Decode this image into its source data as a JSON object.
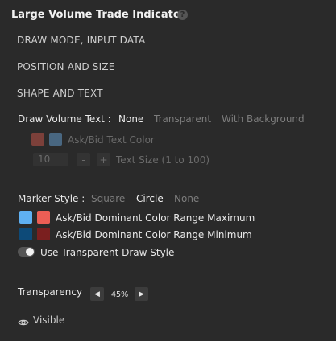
{
  "title": "Large Volume Trade Indicator",
  "help_icon": "question-mark-icon",
  "sections": {
    "draw_mode": "DRAW MODE, INPUT DATA",
    "position": "POSITION AND SIZE",
    "shape": "SHAPE AND TEXT"
  },
  "draw_volume_text": {
    "label": "Draw Volume Text :",
    "options": [
      "None",
      "Transparent",
      "With Background"
    ],
    "selected": "None"
  },
  "ask_bid_text_color": {
    "label": "Ask/Bid Text Color",
    "ask_color": "#e05a4e",
    "bid_color": "#6fb2ea"
  },
  "text_size": {
    "value": "10",
    "minus": "-",
    "plus": "+",
    "label": "Text Size (1 to 100)"
  },
  "marker_style": {
    "label": "Marker Style :",
    "options": [
      "Square",
      "Circle",
      "None"
    ],
    "selected": "Circle"
  },
  "dominant_max": {
    "label": "Ask/Bid Dominant Color Range Maximum",
    "color1": "#5fb0f2",
    "color2": "#ec5e55"
  },
  "dominant_min": {
    "label": "Ask/Bid Dominant Color Range Minimum",
    "color1": "#0d4a78",
    "color2": "#7a1f1f"
  },
  "transparent_draw": {
    "label": "Use Transparent Draw Style",
    "enabled": true
  },
  "transparency": {
    "label": "Transparency",
    "value": "45%"
  },
  "visible": {
    "label": "Visible",
    "icon": "eye-icon"
  }
}
